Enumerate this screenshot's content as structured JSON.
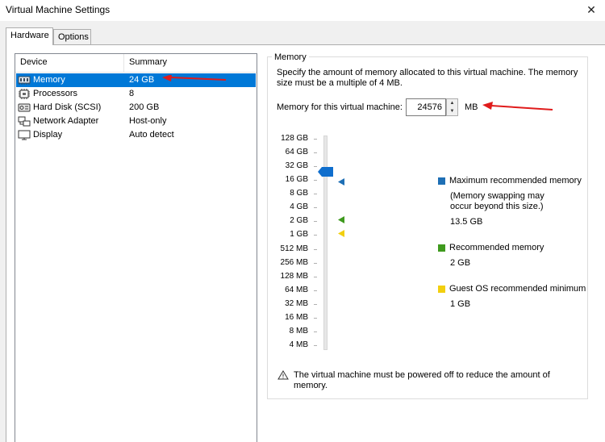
{
  "window": {
    "title": "Virtual Machine Settings",
    "close": "✕"
  },
  "tabs": [
    {
      "label": "Hardware"
    },
    {
      "label": "Options"
    }
  ],
  "device_list": {
    "headers": {
      "device": "Device",
      "summary": "Summary"
    },
    "rows": [
      {
        "name": "Memory",
        "summary": "24 GB",
        "icon": "memory-icon"
      },
      {
        "name": "Processors",
        "summary": "8",
        "icon": "processor-icon"
      },
      {
        "name": "Hard Disk (SCSI)",
        "summary": "200 GB",
        "icon": "hard-disk-icon"
      },
      {
        "name": "Network Adapter",
        "summary": "Host-only",
        "icon": "network-adapter-icon"
      },
      {
        "name": "Display",
        "summary": "Auto detect",
        "icon": "display-icon"
      }
    ]
  },
  "memory_panel": {
    "group_title": "Memory",
    "description": "Specify the amount of memory allocated to this virtual machine. The memory size must be a multiple of 4 MB.",
    "field_label": "Memory for this virtual machine:",
    "value": "24576",
    "unit": "MB",
    "scale": [
      "128 GB",
      "64 GB",
      "32 GB",
      "16 GB",
      "8 GB",
      "4 GB",
      "2 GB",
      "1 GB",
      "512 MB",
      "256 MB",
      "128 MB",
      "64 MB",
      "32 MB",
      "16 MB",
      "8 MB",
      "4 MB"
    ],
    "legend": {
      "max": {
        "label": "Maximum recommended memory",
        "note": "(Memory swapping may occur beyond this size.)",
        "value": "13.5 GB",
        "color": "#1e6fb5"
      },
      "recommended": {
        "label": "Recommended memory",
        "value": "2 GB",
        "color": "#3f9a1e"
      },
      "guest_min": {
        "label": "Guest OS recommended minimum",
        "value": "1 GB",
        "color": "#f2cf0f"
      }
    },
    "warning": "The virtual machine must be powered off to reduce the amount of memory."
  },
  "colors": {
    "selection": "#0078d7",
    "thumb": "#0f6ecd",
    "annotation_arrow": "#e01b1b"
  }
}
